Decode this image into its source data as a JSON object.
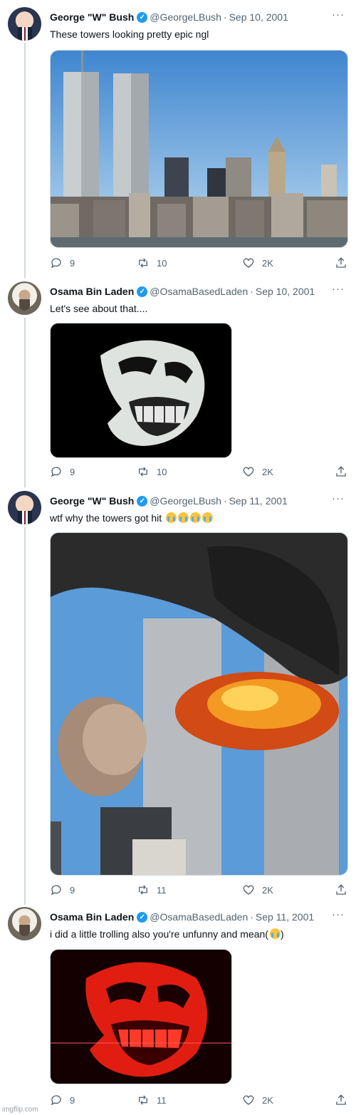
{
  "verified_glyph": "✓",
  "more_glyph": "···",
  "tweets": [
    {
      "name": "George \"W\" Bush",
      "handle": "@GeorgeLBush",
      "dot": "·",
      "date": "Sep 10, 2001",
      "text": "These towers looking pretty epic ngl",
      "media": "twin-towers-skyline-photo",
      "replies": "9",
      "retweets": "10",
      "likes": "2K"
    },
    {
      "name": "Osama Bin Laden",
      "handle": "@OsamaBasedLaden",
      "dot": "·",
      "date": "Sep 10, 2001",
      "text": "Let's see about that....",
      "media": "troll-face-dark-image",
      "replies": "9",
      "retweets": "10",
      "likes": "2K"
    },
    {
      "name": "George \"W\" Bush",
      "handle": "@GeorgeLBush",
      "dot": "·",
      "date": "Sep 11, 2001",
      "text": "wtf why the towers got hit",
      "emoji_count": 4,
      "media": "towers-explosion-photo",
      "replies": "9",
      "retweets": "11",
      "likes": "2K"
    },
    {
      "name": "Osama Bin Laden",
      "handle": "@OsamaBasedLaden",
      "dot": "·",
      "date": "Sep 11, 2001",
      "text": "i did a little trolling also you're unfunny and mean(",
      "text_end": ")",
      "emoji_count": 1,
      "media": "troll-face-red-image",
      "replies": "9",
      "retweets": "11",
      "likes": "2K"
    }
  ],
  "footer": "imgflip.com",
  "colors": {
    "accent": "#1d9bf0",
    "muted": "#536471",
    "thread": "#cfd9de"
  }
}
